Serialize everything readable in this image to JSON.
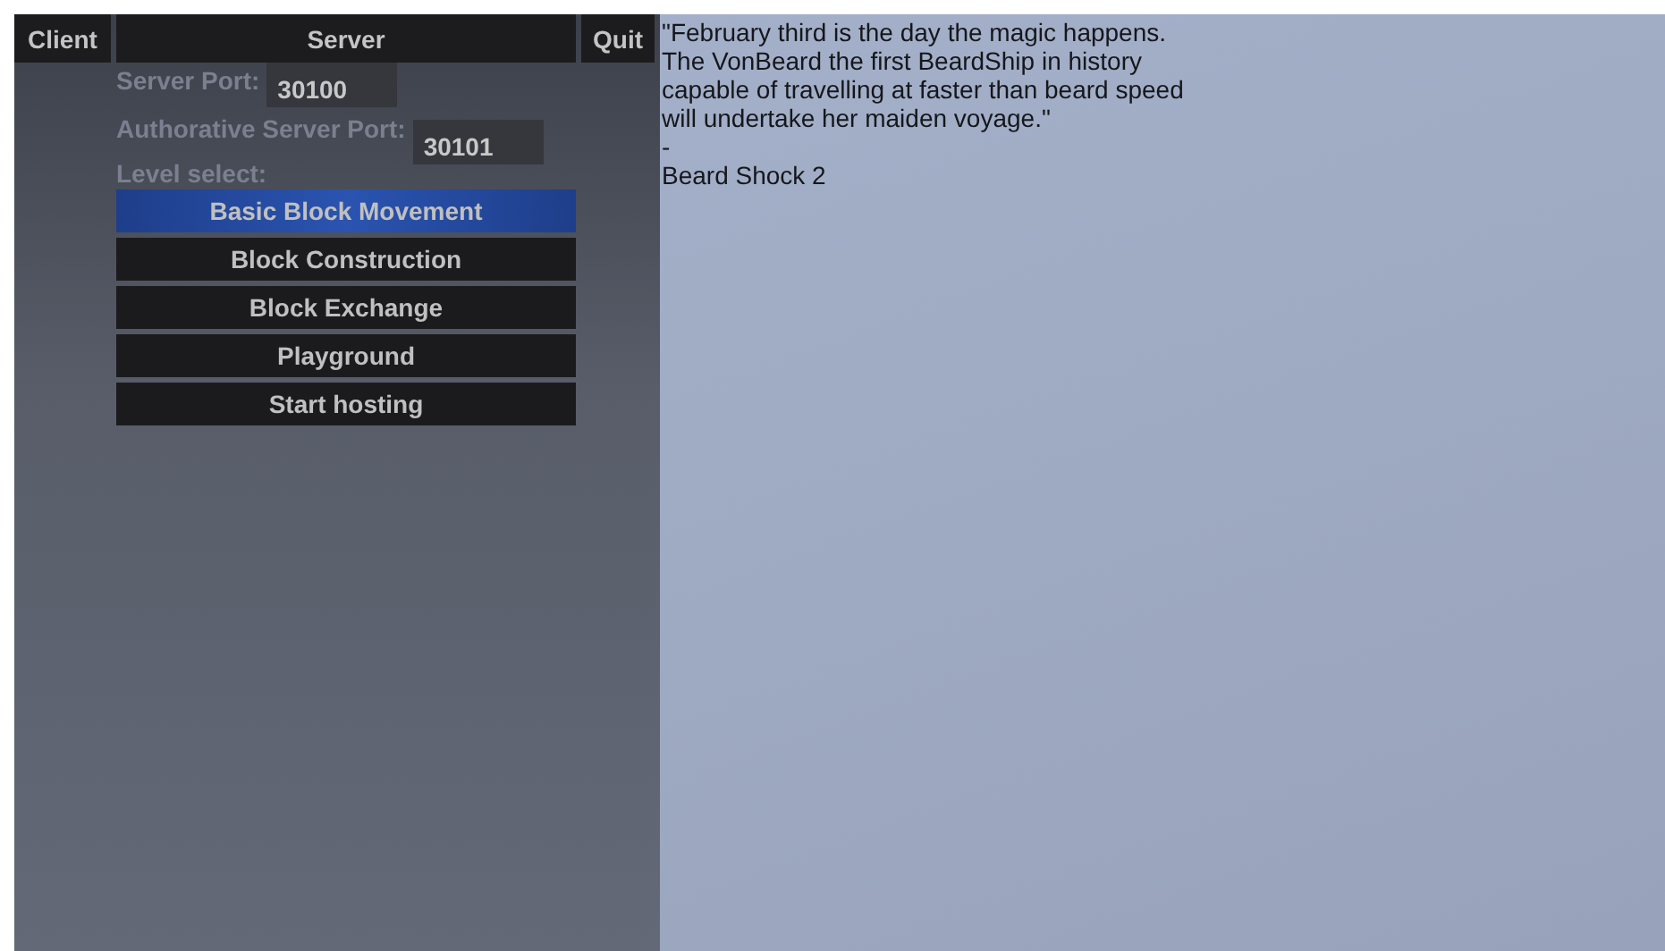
{
  "toolbar": [
    {
      "label": "Client"
    },
    {
      "label": "Server"
    },
    {
      "label": "Quit"
    }
  ],
  "server": {
    "fields": [
      {
        "label": "Server Port:",
        "value": "30100"
      },
      {
        "label": "Authorative Server Port:",
        "value": "30101"
      }
    ],
    "level_label": "Level select:",
    "levels": [
      {
        "label": "Basic Block Movement",
        "selected": true
      },
      {
        "label": "Block Construction",
        "selected": false
      },
      {
        "label": "Block Exchange",
        "selected": false
      },
      {
        "label": "Playground",
        "selected": false
      }
    ],
    "host_button": "Start hosting"
  },
  "quote": {
    "lines": [
      "\"February third is the day the magic happens.",
      "The VonBeard the first BeardShip in history",
      "capable of travelling at faster than beard speed",
      "will undertake her maiden voyage.\""
    ],
    "dash": "-",
    "source": "Beard Shock 2"
  }
}
